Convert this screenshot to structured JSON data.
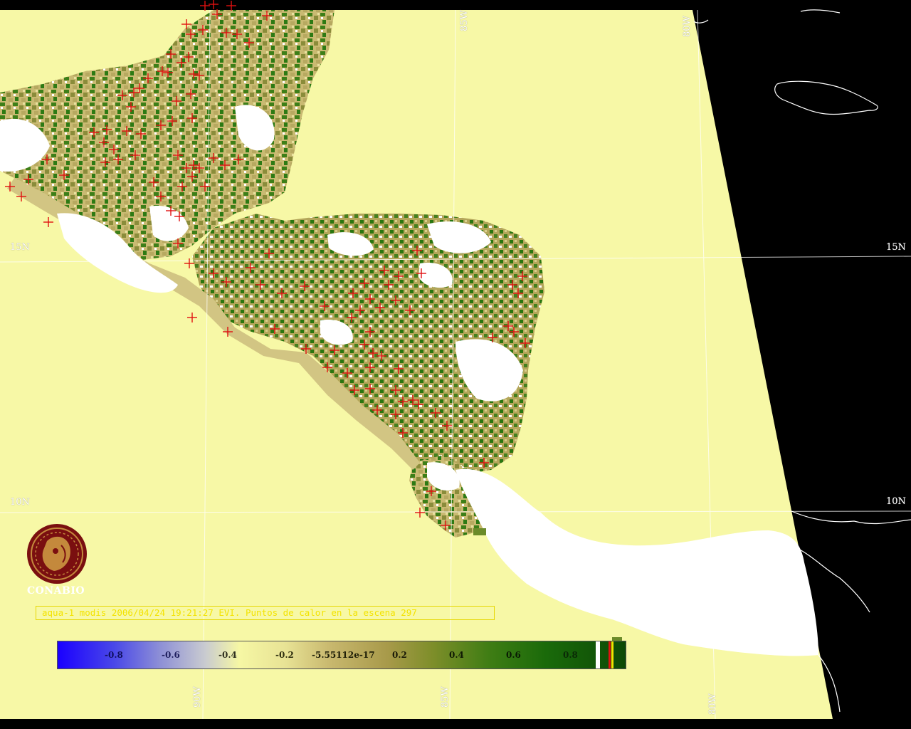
{
  "grid_labels": {
    "lon_top_85": "85W",
    "lon_top_80": "80W",
    "lat_15_left": "15N",
    "lat_15_right": "15N",
    "lat_10_left": "10N",
    "lat_10_right": "10N",
    "lon_bottom_90": "90W",
    "lon_bottom_85": "85W",
    "lon_bottom_80": "80W"
  },
  "logo": {
    "name": "CONABIO"
  },
  "banner": {
    "text": "aqua-1 modis 2006/04/24 19:21:27 EVI. Puntos de calor en la escena 297"
  },
  "colorbar": {
    "ticks": [
      "-0.8",
      "-0.6",
      "-0.4",
      "-0.2",
      "-5.55112e-17",
      "0.2",
      "0.4",
      "0.6",
      "0.8"
    ]
  },
  "colors": {
    "ocean": "#f7f8a6",
    "background": "#000000",
    "vegetation_dark": "#2d7a14",
    "vegetation_light": "#c8b86e",
    "cloud": "#ffffff",
    "hotspot": "#e01010",
    "logo": "#7a0f10"
  }
}
